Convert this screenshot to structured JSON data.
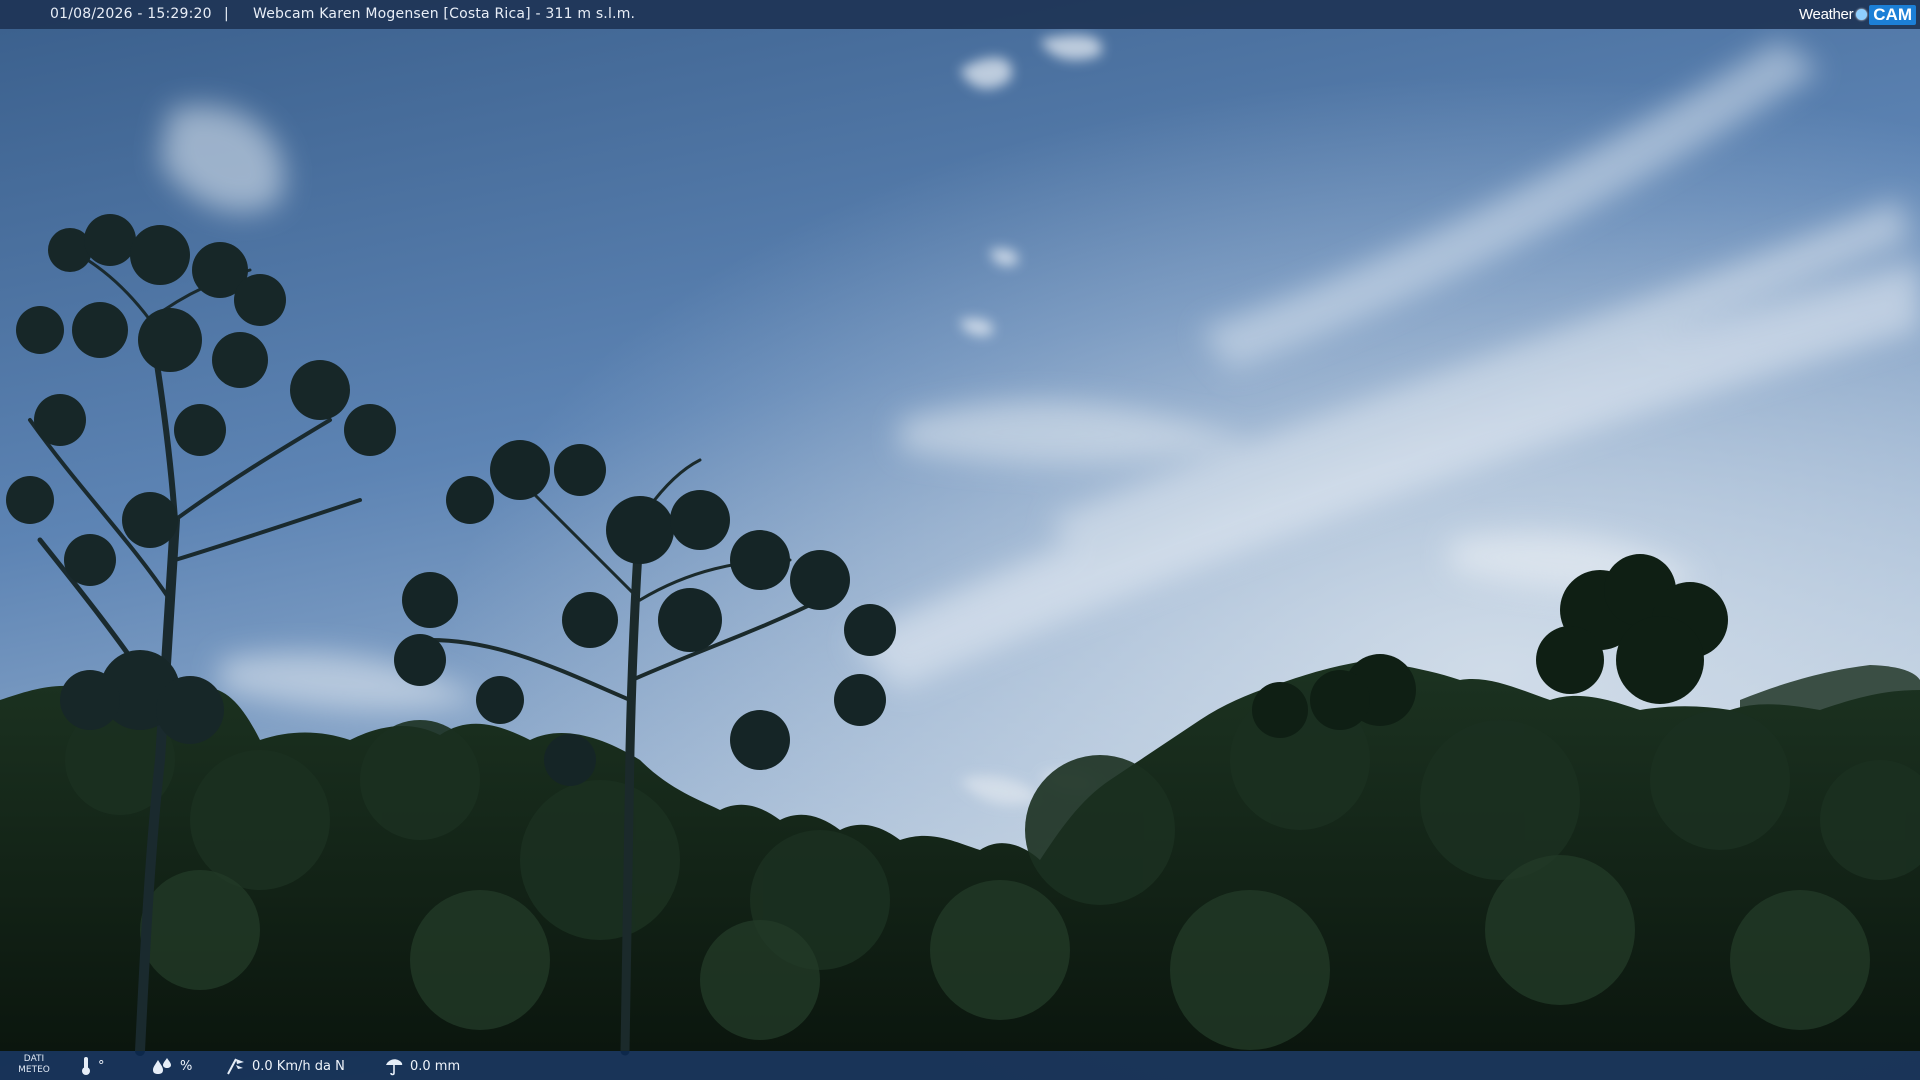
{
  "overlay": {
    "timestamp": "01/08/2026 - 15:29:20",
    "separator": "|",
    "camera_title": "Webcam Karen Mogensen [Costa Rica]  - 311 m s.l.m."
  },
  "logo": {
    "word": "Weather",
    "cam": "CAM"
  },
  "weather_bar": {
    "label": "DATI METEO",
    "temperature": "°",
    "humidity": "%",
    "wind": "0.0 Km/h da N",
    "rain": "0.0 mm"
  },
  "colors": {
    "sky_top": "#3f6591",
    "sky_mid": "#6f93bf",
    "sky_horizon": "#c4d3e2",
    "forest": "#142519",
    "bar_top": "#1e3456",
    "bar_bottom": "#0c284e",
    "logo_accent": "#1c7fd6"
  },
  "icons": {
    "temperature": "thermometer-icon",
    "humidity": "water-drops-icon",
    "wind": "wind-vane-icon",
    "rain": "rain-gauge-icon"
  }
}
